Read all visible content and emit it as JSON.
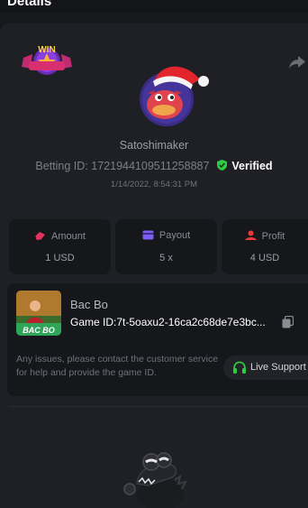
{
  "header": {
    "title": "Details"
  },
  "badge": {
    "text": "WIN"
  },
  "player": {
    "username": "Satoshimaker",
    "betting_label": "Betting ID:",
    "betting_id": "1721944109511258887",
    "verified": "Verified",
    "timestamp": "1/14/2022, 8:54:31 PM"
  },
  "stats": [
    {
      "label": "Amount",
      "value": "1 USD",
      "icon": "amount-icon",
      "color": "#e3325d"
    },
    {
      "label": "Payout",
      "value": "5 x",
      "icon": "payout-icon",
      "color": "#7b5cf5"
    },
    {
      "label": "Profit",
      "value": "4 USD",
      "icon": "profit-icon",
      "color": "#e53b3b"
    }
  ],
  "game": {
    "name": "Bac Bo",
    "thumb_label": "BAC BO",
    "id_label": "Game ID:",
    "id_value": "7t-5oaxu2-16ca2c68de7e3bc...",
    "issues_text": "Any issues, please contact the customer service for help and provide the game ID.",
    "support_label": "Live Support"
  },
  "colors": {
    "background": "#17181c",
    "card": "#1f2025",
    "verified": "#2ecc40",
    "support_icon": "#2ecc40"
  }
}
